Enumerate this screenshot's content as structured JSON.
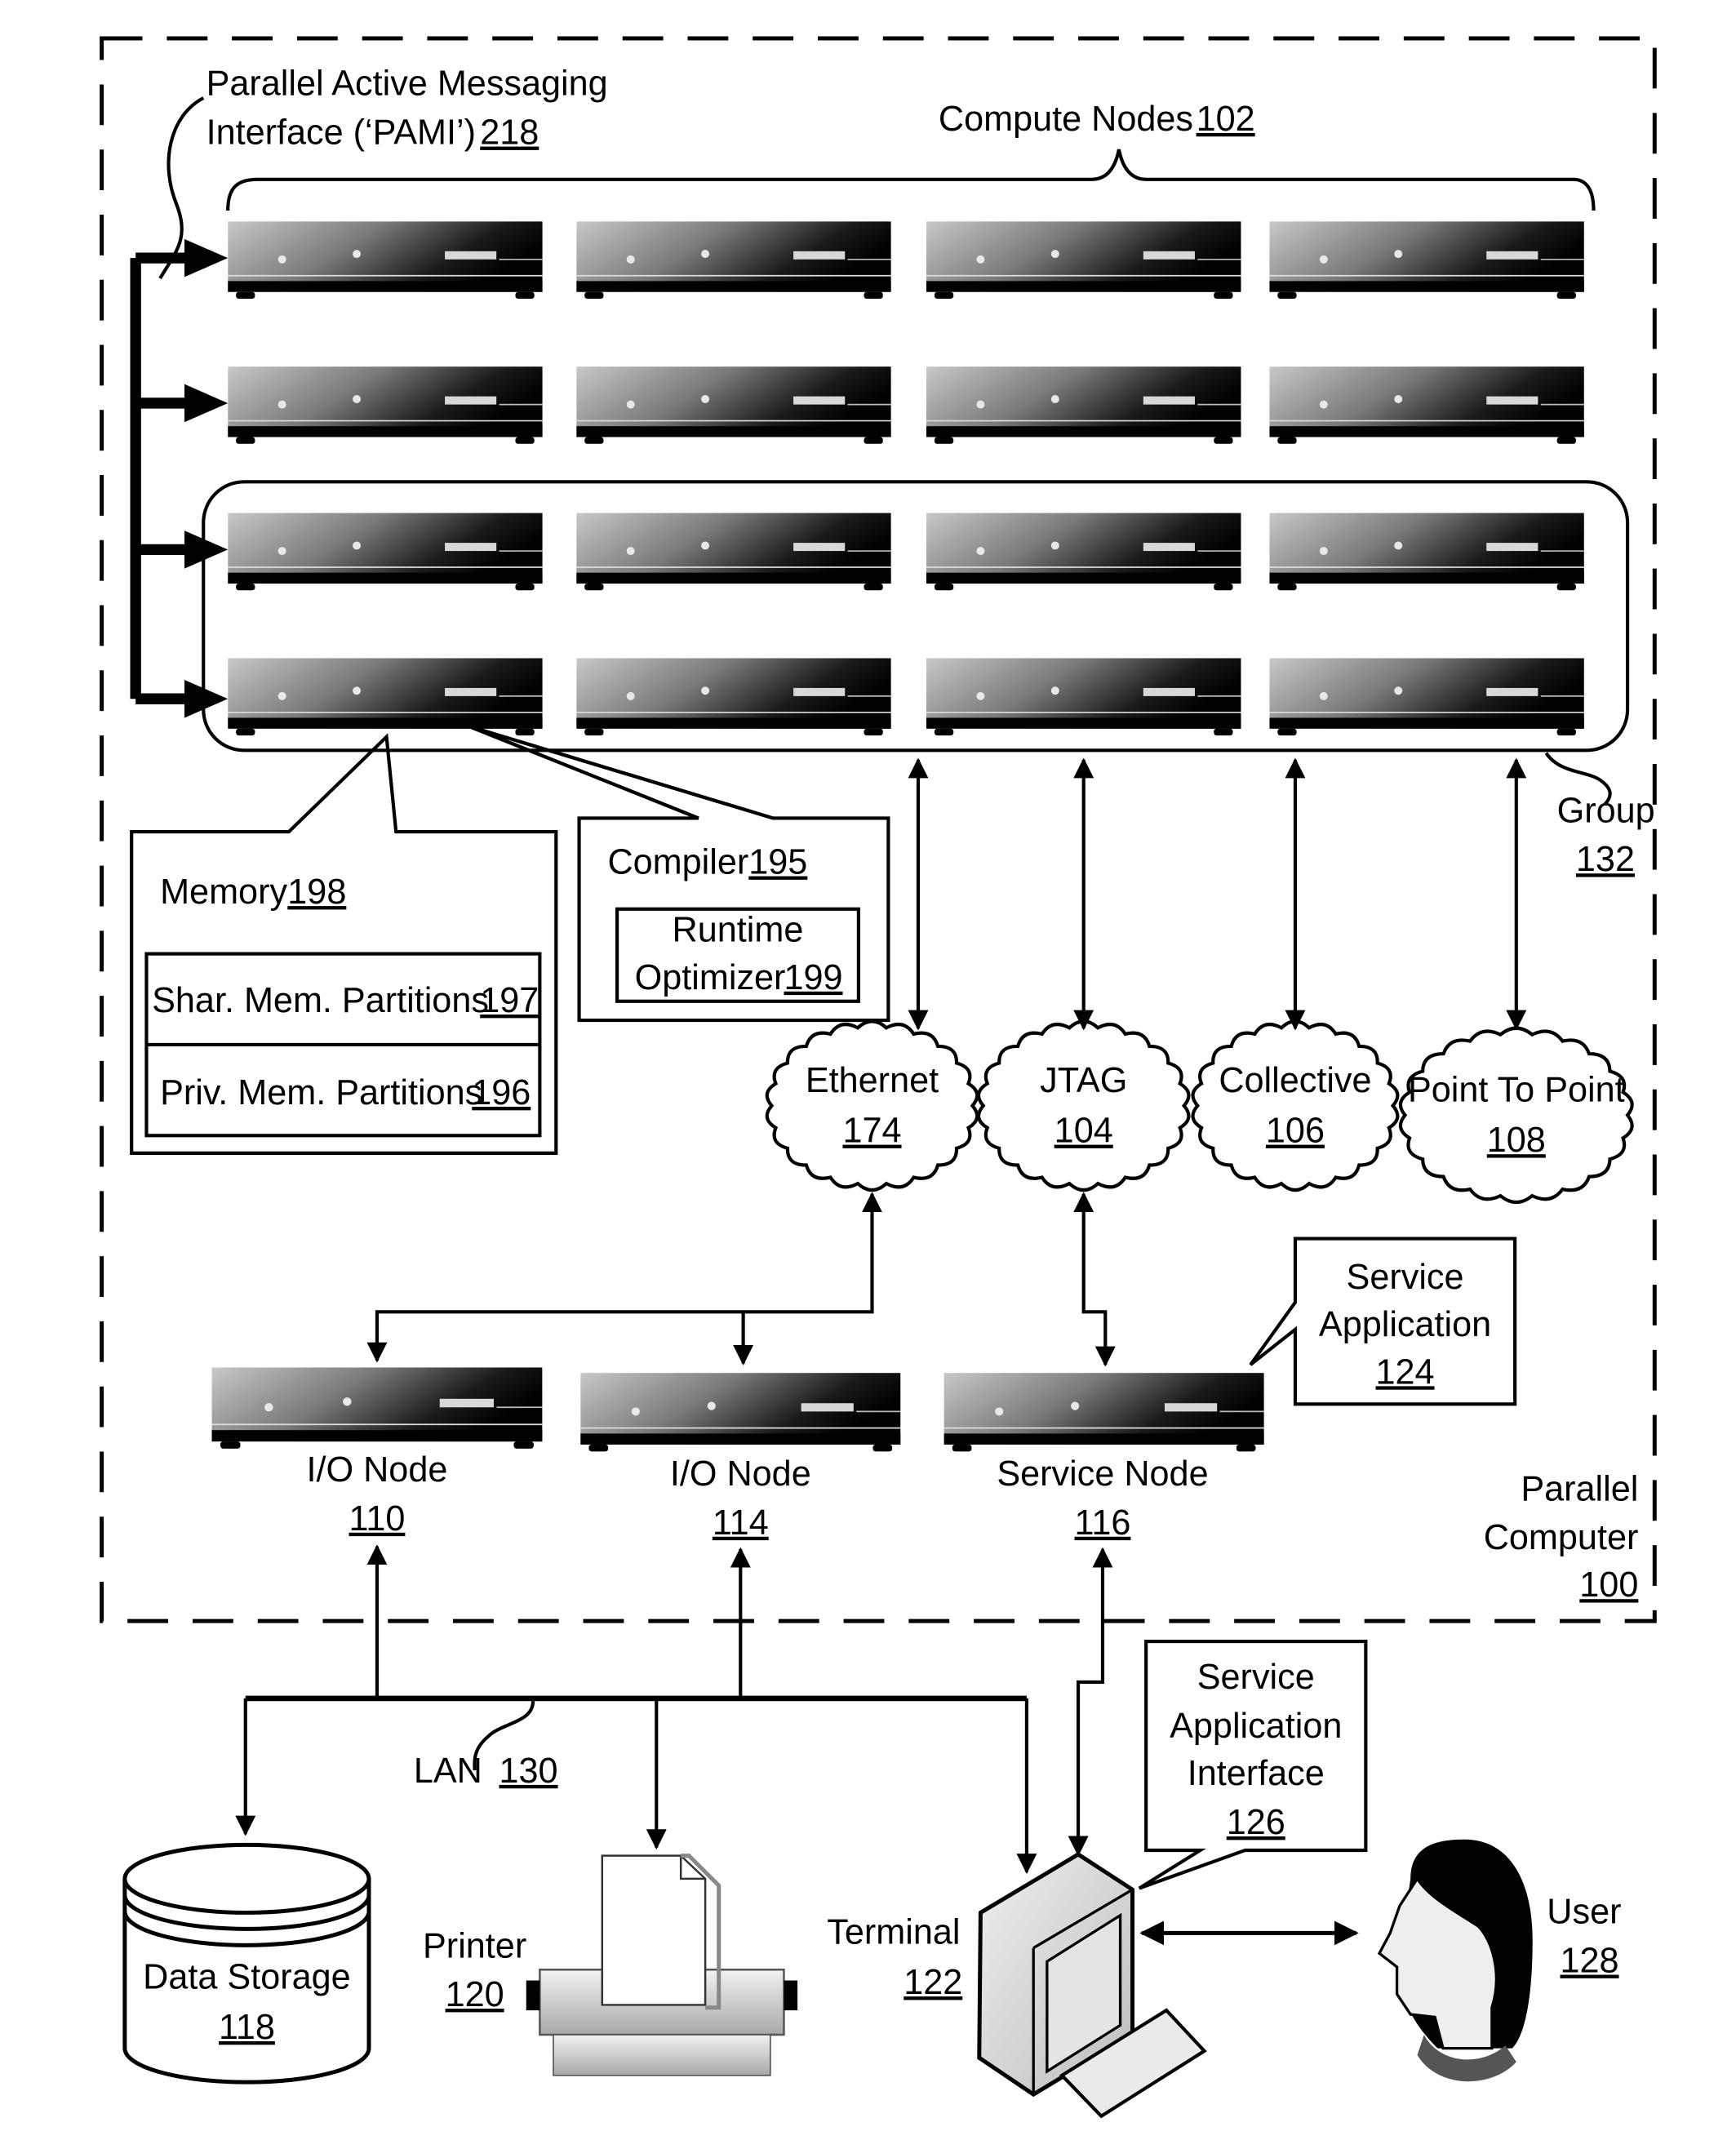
{
  "diagram": {
    "title": "Parallel Computer",
    "parallel_computer": {
      "label": "Parallel Computer",
      "ref": "100"
    },
    "pami": {
      "line1": "Parallel Active Messaging",
      "line2": "Interface (‘PAMI’)",
      "ref": "218"
    },
    "compute_nodes": {
      "label": "Compute Nodes",
      "ref": "102",
      "rows": 4,
      "columns": 4
    },
    "group": {
      "label": "Group",
      "ref": "132"
    },
    "memory": {
      "label": "Memory",
      "ref": "198"
    },
    "shared_partitions": {
      "label": "Shar. Mem. Partitions",
      "ref": "197"
    },
    "private_partitions": {
      "label": "Priv. Mem. Partitions",
      "ref": "196"
    },
    "compiler": {
      "label": "Compiler",
      "ref": "195"
    },
    "runtime_optimizer": {
      "line1": "Runtime",
      "line2": "Optimizer",
      "ref": "199"
    },
    "networks": [
      {
        "label": "Ethernet",
        "ref": "174"
      },
      {
        "label": "JTAG",
        "ref": "104"
      },
      {
        "label": "Collective",
        "ref": "106"
      },
      {
        "label": "Point To Point",
        "ref": "108"
      }
    ],
    "service_application": {
      "line1": "Service",
      "line2": "Application",
      "ref": "124"
    },
    "io_nodes": [
      {
        "label": "I/O Node",
        "ref": "110"
      },
      {
        "label": "I/O Node",
        "ref": "114"
      }
    ],
    "service_node": {
      "label": "Service Node",
      "ref": "116"
    },
    "lan": {
      "label": "LAN",
      "ref": "130"
    },
    "service_application_interface": {
      "line1": "Service",
      "line2": "Application",
      "line3": "Interface",
      "ref": "126"
    },
    "data_storage": {
      "label": "Data Storage",
      "ref": "118"
    },
    "printer": {
      "label": "Printer",
      "ref": "120"
    },
    "terminal": {
      "label": "Terminal",
      "ref": "122"
    },
    "user": {
      "label": "User",
      "ref": "128"
    }
  }
}
